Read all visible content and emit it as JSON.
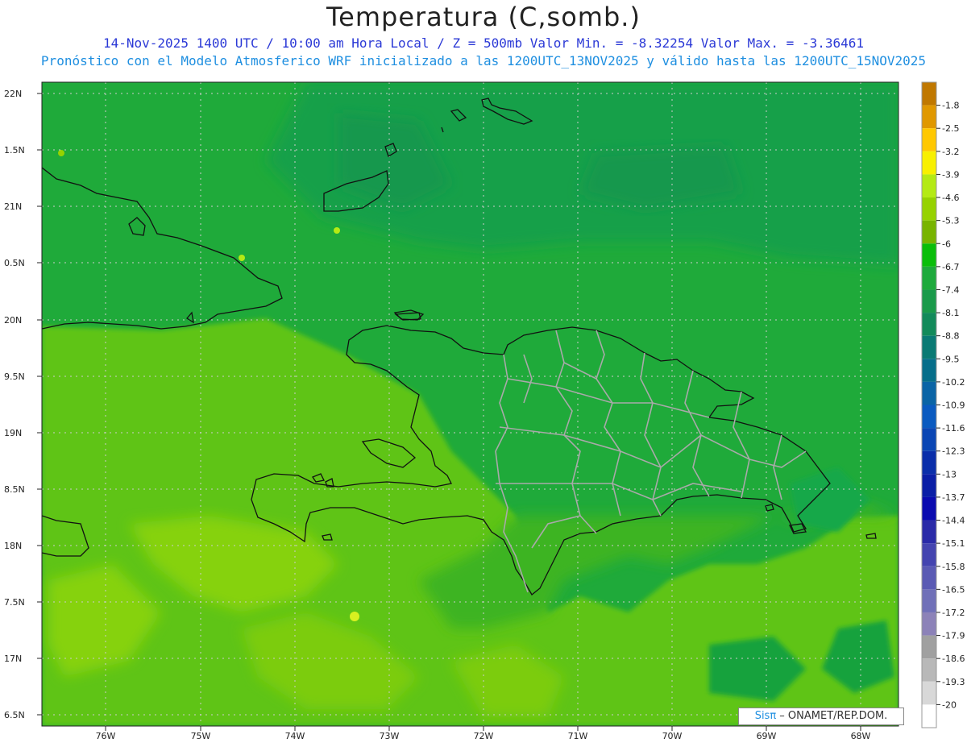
{
  "header": {
    "title": "Temperatura (C,somb.)",
    "subtitle_1": "14-Nov-2025 1400 UTC / 10:00 am Hora Local / Z = 500mb Valor Min. = -8.32254 Valor Max. = -3.36461",
    "subtitle_2": "Pronóstico con el Modelo Atmosferico WRF inicializado a las 1200UTC_13NOV2025 y válido hasta las 1200UTC_15NOV2025"
  },
  "axes": {
    "lat_labels": [
      "22N",
      "1.5N",
      "21N",
      "0.5N",
      "20N",
      "9.5N",
      "19N",
      "8.5N",
      "18N",
      "7.5N",
      "17N",
      "6.5N"
    ],
    "lon_labels": [
      "76W",
      "75W",
      "74W",
      "73W",
      "72W",
      "71W",
      "70W",
      "69W",
      "68W"
    ],
    "grid": "dotted"
  },
  "colorbar": {
    "labels": [
      "-1.8",
      "-2.5",
      "-3.2",
      "-3.9",
      "-4.6",
      "-5.3",
      "-6",
      "-6.7",
      "-7.4",
      "-8.1",
      "-8.8",
      "-9.5",
      "-10.2",
      "-10.9",
      "-11.6",
      "-12.3",
      "-13",
      "-13.7",
      "-14.4",
      "-15.1",
      "-15.8",
      "-16.5",
      "-17.2",
      "-17.9",
      "-18.6",
      "-19.3",
      "-20"
    ],
    "colors": [
      "#c07800",
      "#e09800",
      "#ffc800",
      "#f8f000",
      "#b4ea14",
      "#96d200",
      "#78b400",
      "#0abe0a",
      "#1eaa3c",
      "#1a9a4a",
      "#128a5a",
      "#0a7a74",
      "#066e8a",
      "#0a64a6",
      "#0a5ac0",
      "#0a46b4",
      "#0a2eaa",
      "#0a1ea6",
      "#0a0ab0",
      "#2a2aa8",
      "#4444b0",
      "#5a5ab4",
      "#7070b8",
      "#8c82b8",
      "#a0a0a0",
      "#b8b8b8",
      "#d8d8d8"
    ]
  },
  "field": {
    "min": -8.32254,
    "max": -3.36461
  },
  "credit": {
    "brand": "Sisπ",
    "text": " – ONAMET/REP.DOM."
  }
}
